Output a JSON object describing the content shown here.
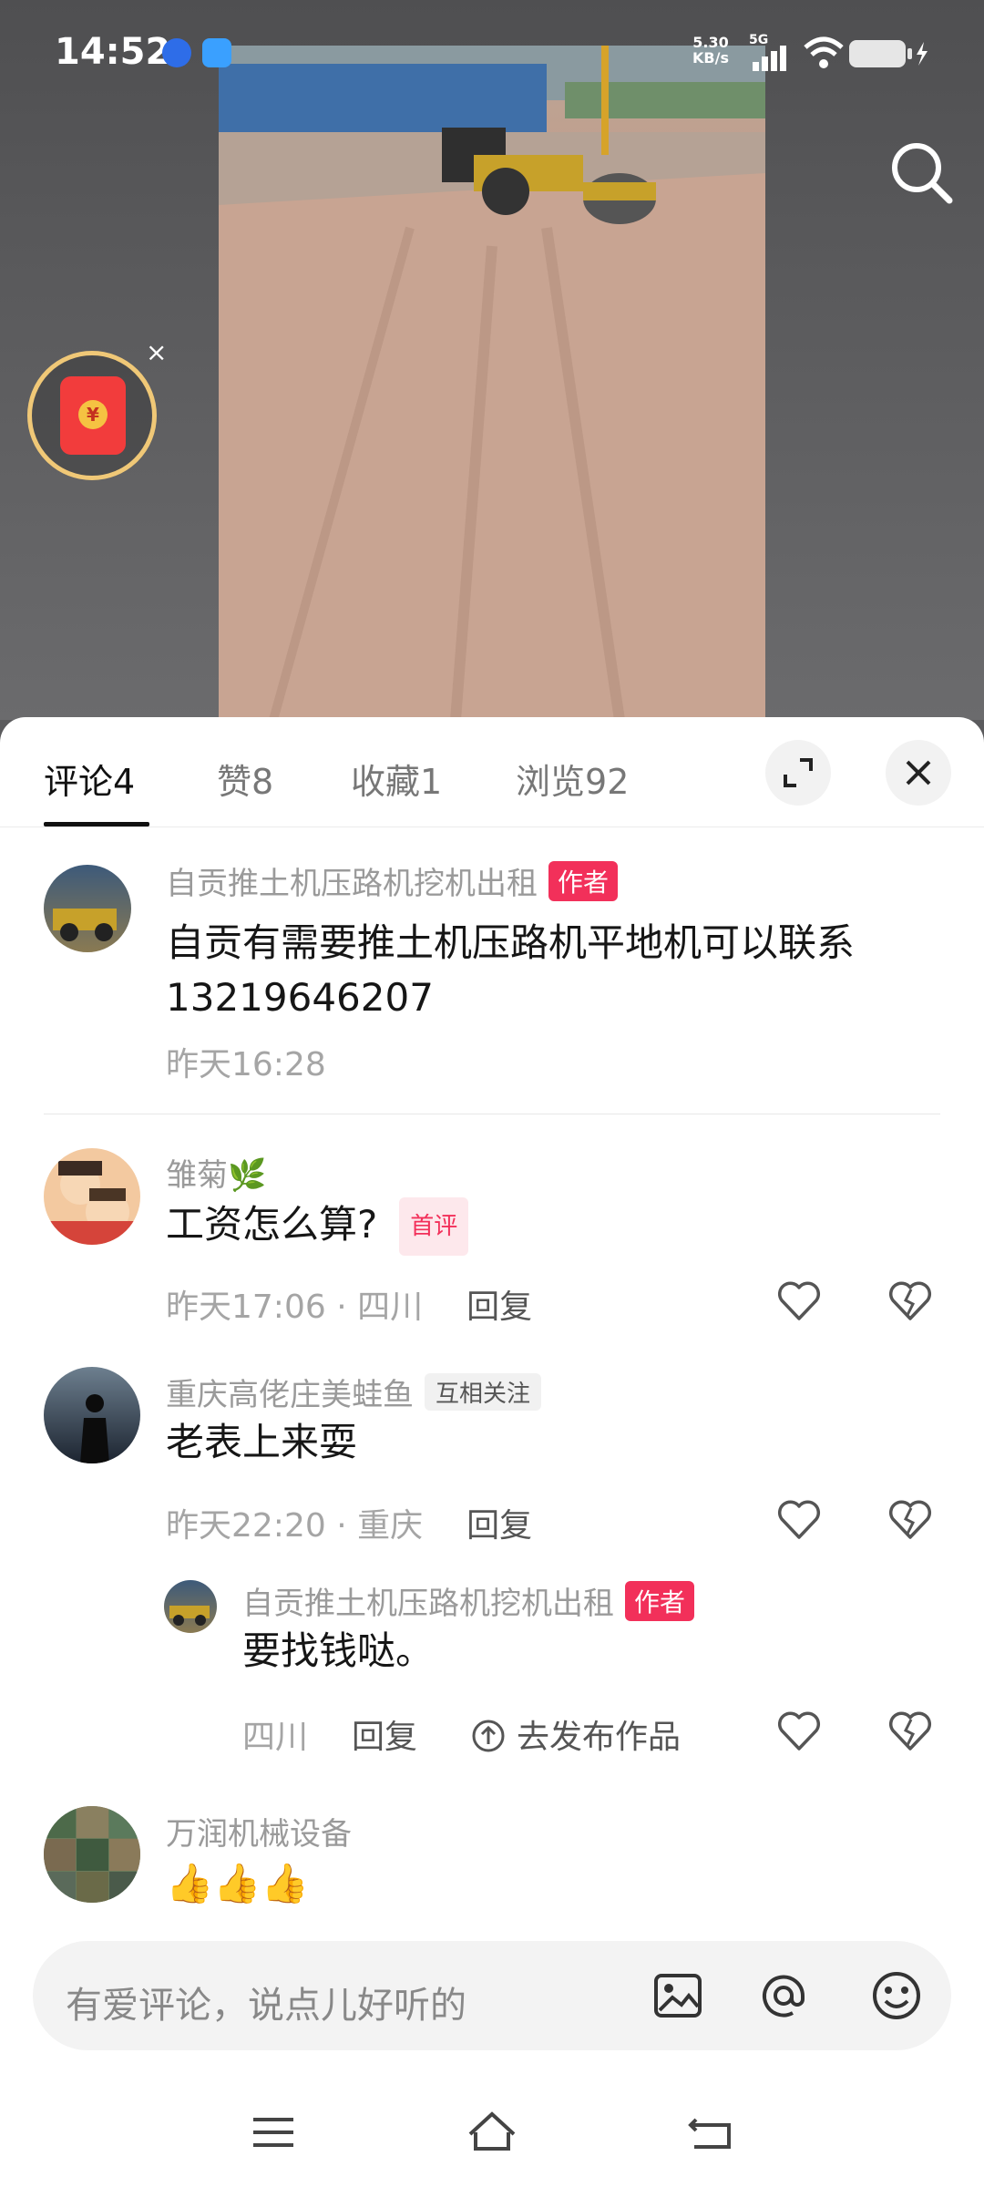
{
  "status": {
    "time": "14:52",
    "net_speed_top": "5.30",
    "net_speed_bottom": "KB/s",
    "signal_label": "5G"
  },
  "icons": {
    "search": "search-icon",
    "red_packet": "red-envelope-icon",
    "close": "close-icon",
    "expand": "expand-icon"
  },
  "tabs": [
    {
      "label": "评论",
      "count": "4"
    },
    {
      "label": "赞",
      "count": "8"
    },
    {
      "label": "收藏",
      "count": "1"
    },
    {
      "label": "浏览",
      "count": "92"
    }
  ],
  "comments": {
    "c1": {
      "user": "自贡推土机压路机挖机出租",
      "badge": "作者",
      "text": "自贡有需要推土机压路机平地机可以联系13219646207",
      "time": "昨天16:28"
    },
    "c2": {
      "user": "雏菊🌿",
      "text": "工资怎么算?",
      "badge": "首评",
      "time": "昨天17:06 · 四川",
      "reply": "回复"
    },
    "c3": {
      "user": "重庆高佬庄美蛙鱼",
      "badge": "互相关注",
      "text": "老表上来耍",
      "time": "昨天22:20 · 重庆",
      "reply": "回复"
    },
    "c4": {
      "user": "自贡推土机压路机挖机出租",
      "badge": "作者",
      "text": "要找钱哒。",
      "time": "四川",
      "reply": "回复",
      "publish": "去发布作品"
    },
    "c5": {
      "user": "万润机械设备",
      "text": "👍👍👍"
    }
  },
  "input": {
    "placeholder": "有爱评论，说点儿好听的"
  },
  "colors": {
    "accent": "#f2305a",
    "gold": "#f0c877",
    "red_packet": "#f23c3c"
  }
}
